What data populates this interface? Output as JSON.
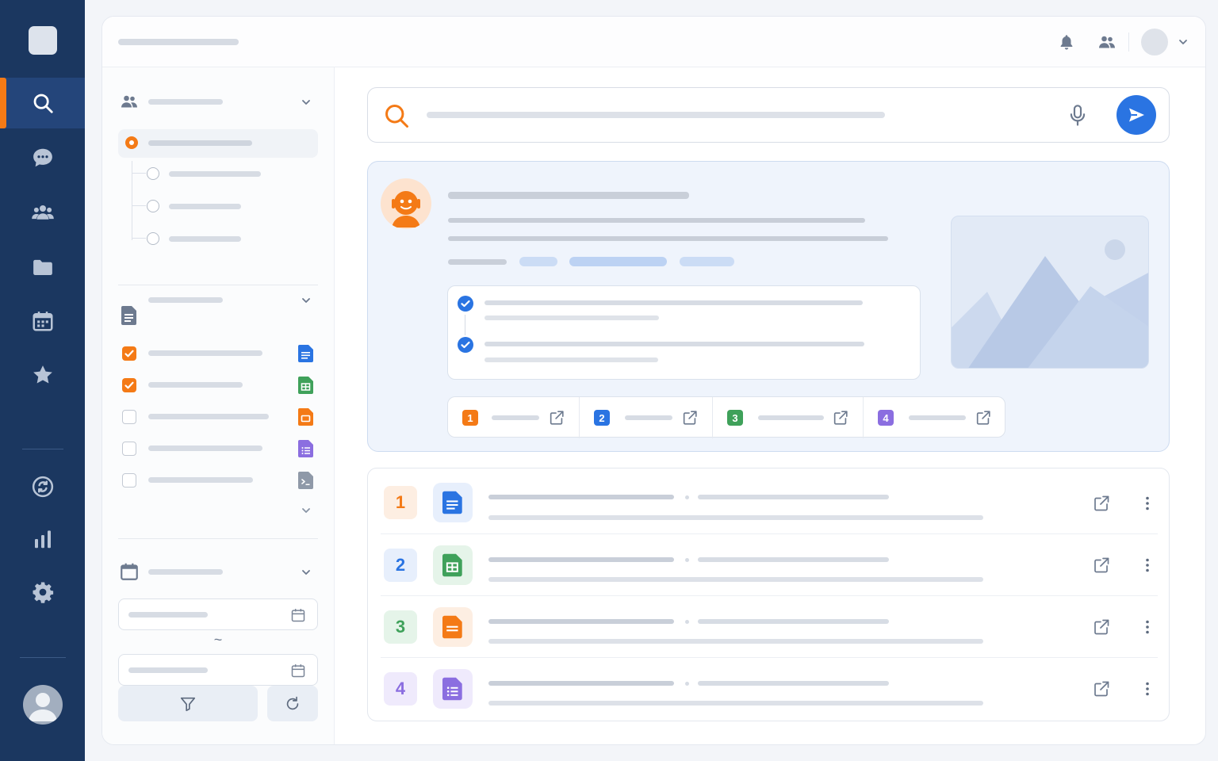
{
  "nav": {
    "items": [
      {
        "icon": "search-icon",
        "active": true
      },
      {
        "icon": "chat-bubble-icon",
        "active": false
      },
      {
        "icon": "users-icon",
        "active": false
      },
      {
        "icon": "folder-icon",
        "active": false
      },
      {
        "icon": "calendar-icon",
        "active": false
      },
      {
        "icon": "star-icon",
        "active": false
      }
    ],
    "secondary": [
      {
        "icon": "sync-coin-icon"
      },
      {
        "icon": "bar-chart-icon"
      },
      {
        "icon": "gear-icon"
      }
    ],
    "user": {
      "icon": "user-avatar-icon"
    }
  },
  "topbar": {
    "icons": [
      "bell-icon",
      "team-icon",
      "chevron-down-icon"
    ]
  },
  "filters": {
    "groups": [
      {
        "icon": "users-icon",
        "type": "radio",
        "selected_index": 0,
        "option_count": 4
      },
      {
        "icon": "document-icon",
        "type": "checkbox",
        "checked": [
          true,
          true,
          false,
          false,
          false
        ],
        "file_types": [
          "doc",
          "sheet",
          "slides",
          "form",
          "script"
        ]
      },
      {
        "icon": "calendar-icon",
        "type": "date-range",
        "separator": "~"
      }
    ],
    "buttons": {
      "apply_icon": "filter-icon",
      "reset_icon": "refresh-icon"
    }
  },
  "search": {
    "icon": "search-icon",
    "mic_icon": "microphone-icon",
    "send_icon": "send-icon"
  },
  "answer": {
    "avatar_icon": "robot-avatar-icon",
    "steps_done": [
      true,
      true
    ],
    "image_icon": "image-placeholder-icon",
    "citations": [
      {
        "label": "1",
        "color": "#f47a16"
      },
      {
        "label": "2",
        "color": "#2a74e2"
      },
      {
        "label": "3",
        "color": "#3fa15a"
      },
      {
        "label": "4",
        "color": "#8b6ee0"
      }
    ]
  },
  "colors": {
    "nav_bg": "#1b3760",
    "accent_orange": "#f47a16",
    "accent_blue": "#2a74e2",
    "green": "#3fa15a",
    "purple": "#8b6ee0"
  },
  "results": [
    {
      "rank": "1",
      "type": "doc",
      "rank_color": "#f47a16",
      "rank_bg": "#fdeee2",
      "icon_color": "#2a74e2",
      "icon_bg": "#e7effc"
    },
    {
      "rank": "2",
      "type": "sheet",
      "rank_color": "#2a74e2",
      "rank_bg": "#e7effc",
      "icon_color": "#3fa15a",
      "icon_bg": "#e5f4e9"
    },
    {
      "rank": "3",
      "type": "slides",
      "rank_color": "#3fa15a",
      "rank_bg": "#e5f4e9",
      "icon_color": "#f47a16",
      "icon_bg": "#fdeee2"
    },
    {
      "rank": "4",
      "type": "form",
      "rank_color": "#8b6ee0",
      "rank_bg": "#efeafc",
      "icon_color": "#8b6ee0",
      "icon_bg": "#efeafc"
    }
  ]
}
